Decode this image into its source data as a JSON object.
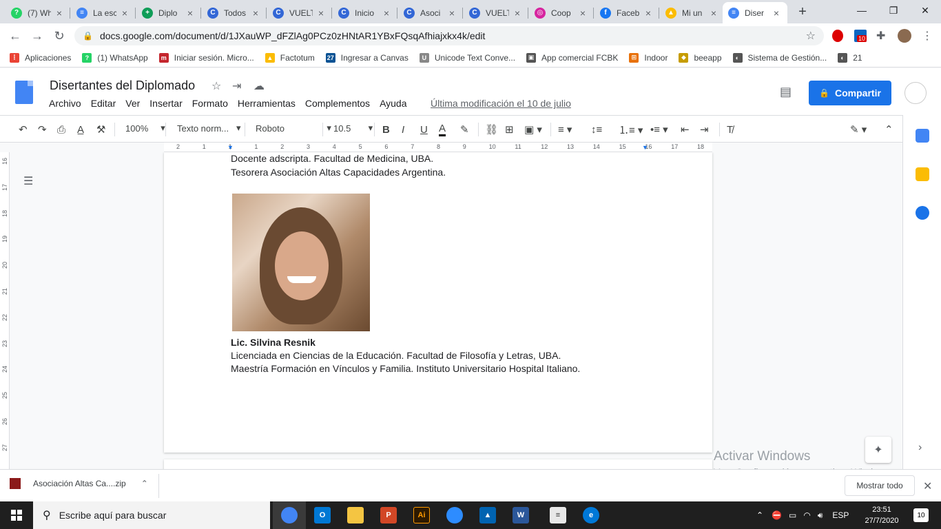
{
  "tabs": [
    {
      "title": "(7) Wh",
      "color": "#25d366",
      "glyph": "?"
    },
    {
      "title": "La esc",
      "color": "#4285f4",
      "glyph": "≡"
    },
    {
      "title": "Diplo",
      "color": "#0f9d58",
      "glyph": "+"
    },
    {
      "title": "Todos",
      "color": "#3367d6",
      "glyph": "C"
    },
    {
      "title": "VUELT",
      "color": "#3367d6",
      "glyph": "C"
    },
    {
      "title": "Inicio",
      "color": "#3367d6",
      "glyph": "C"
    },
    {
      "title": "Asoci",
      "color": "#3367d6",
      "glyph": "C"
    },
    {
      "title": "VUELT",
      "color": "#3367d6",
      "glyph": "C"
    },
    {
      "title": "Coop",
      "color": "#d6249f",
      "glyph": "◎"
    },
    {
      "title": "Faceb",
      "color": "#1877f2",
      "glyph": "f"
    },
    {
      "title": "Mi un",
      "color": "#fbbc04",
      "glyph": "▲"
    },
    {
      "title": "Diser",
      "color": "#4285f4",
      "glyph": "≡",
      "active": true
    }
  ],
  "address": {
    "url": "docs.google.com/document/d/1JXauWP_dFZlAg0PCz0zHNtAR1YBxFQsqAfhiajxkx4k/edit"
  },
  "extension_badge": "10",
  "bookmarks": [
    {
      "label": "Aplicaciones",
      "color": "#ea4335",
      "glyph": "⋮"
    },
    {
      "label": "(1) WhatsApp",
      "color": "#25d366",
      "glyph": "?"
    },
    {
      "label": "Iniciar sesión. Micro...",
      "color": "#c4262e",
      "glyph": "m"
    },
    {
      "label": "Factotum",
      "color": "#fbbc04",
      "glyph": "▲"
    },
    {
      "label": "Ingresar a Canvas",
      "color": "#0b5394",
      "glyph": "27"
    },
    {
      "label": "Unicode Text Conve...",
      "color": "#888888",
      "glyph": "U"
    },
    {
      "label": "App comercial FCBK",
      "color": "#555555",
      "glyph": "▣"
    },
    {
      "label": "Indoor",
      "color": "#e8710a",
      "glyph": "⊞"
    },
    {
      "label": "beeapp",
      "color": "#c69c00",
      "glyph": "◆"
    },
    {
      "label": "Sistema de Gestión...",
      "color": "#555555",
      "glyph": "◐"
    },
    {
      "label": "21",
      "color": "#555555",
      "glyph": "◐"
    }
  ],
  "doc": {
    "title": "Disertantes del Diplomado",
    "menu": [
      "Archivo",
      "Editar",
      "Ver",
      "Insertar",
      "Formato",
      "Herramientas",
      "Complementos",
      "Ayuda"
    ],
    "last_modified": "Última modificación el 10 de julio",
    "share_label": "Compartir"
  },
  "format_toolbar": {
    "zoom": "100%",
    "style": "Texto norm...",
    "font": "Roboto",
    "size": "10.5"
  },
  "ruler": {
    "h_ticks": [
      "2",
      "1",
      "1",
      "1",
      "2",
      "3",
      "4",
      "5",
      "6",
      "7",
      "8",
      "9",
      "10",
      "11",
      "12",
      "13",
      "14",
      "15",
      "16",
      "17",
      "18"
    ],
    "v_ticks": [
      "16",
      "17",
      "18",
      "19",
      "20",
      "21",
      "22",
      "23",
      "24",
      "25",
      "26",
      "27"
    ]
  },
  "content": {
    "line1": "Docente adscripta. Facultad de Medicina, UBA.",
    "line2": "Tesorera Asociación Altas Capacidades Argentina.",
    "name": "Lic. Silvina Resnik",
    "line3": "Licenciada en Ciencias de la Educación. Facultad de Filosofía y Letras, UBA.",
    "line4": "Maestría Formación en Vínculos y Familia. Instituto Universitario Hospital Italiano."
  },
  "watermark": {
    "line1": "Activar Windows",
    "line2": "Ve a Configuración para activar Windows."
  },
  "download": {
    "file": "Asociación Altas Ca....zip",
    "show_all": "Mostrar todo"
  },
  "taskbar": {
    "search_placeholder": "Escribe aquí para buscar",
    "lang": "ESP",
    "time": "23:51",
    "date": "27/7/2020",
    "notifications": "10"
  }
}
